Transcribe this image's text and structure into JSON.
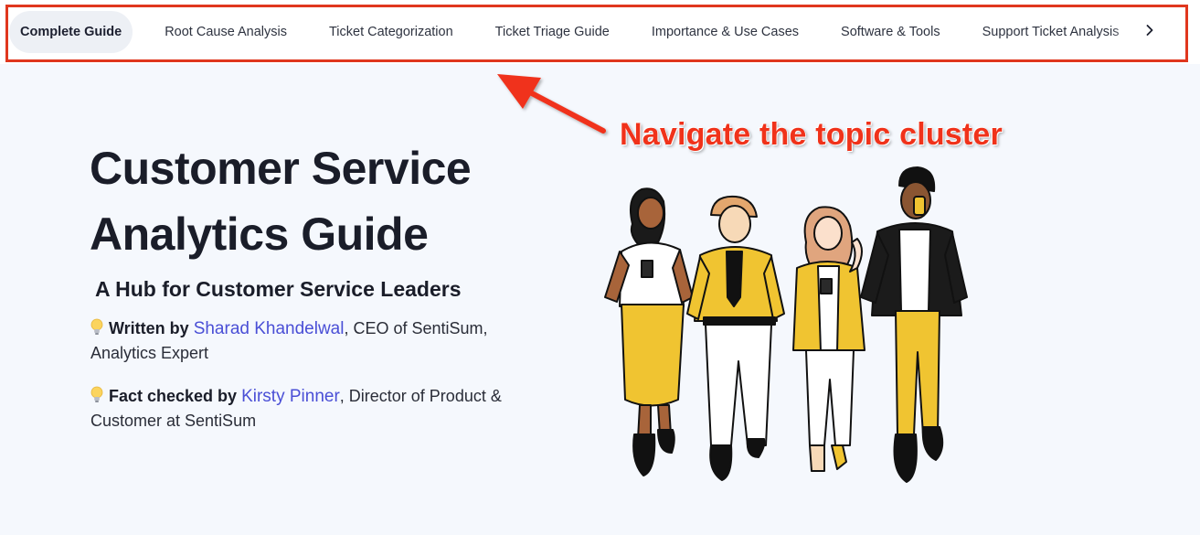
{
  "tabs": [
    {
      "label": "Complete Guide",
      "active": true
    },
    {
      "label": "Root Cause Analysis",
      "active": false
    },
    {
      "label": "Ticket Categorization",
      "active": false
    },
    {
      "label": "Ticket Triage Guide",
      "active": false
    },
    {
      "label": "Importance & Use Cases",
      "active": false
    },
    {
      "label": "Software & Tools",
      "active": false
    },
    {
      "label": "Support Ticket Analysis",
      "active": false
    }
  ],
  "tab_next_icon": "chevron-right-icon",
  "annotation": {
    "text": "Navigate the topic cluster",
    "color": "#f0321a"
  },
  "hero": {
    "title_line1": "Customer Service",
    "title_line2": "Analytics Guide",
    "subtitle": "A Hub for Customer Service Leaders",
    "written_by_label": "Written by",
    "author_name": "Sharad Khandelwal",
    "author_role": ", CEO of SentiSum, Analytics Expert",
    "fact_checked_label": "Fact checked by",
    "checker_name": "Kirsty Pinner",
    "checker_role": ", Director of Product & Customer at SentiSum",
    "bulb_icon": "lightbulb-icon"
  },
  "colors": {
    "background": "#f5f8fd",
    "link": "#4a4fd6",
    "highlight_border": "#e0371e",
    "illustration_yellow": "#f0c431"
  }
}
